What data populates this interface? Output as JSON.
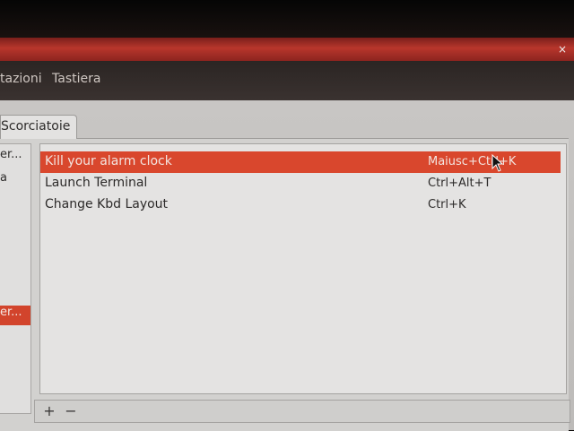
{
  "window": {
    "close_glyph": "×"
  },
  "menubar": {
    "items": [
      "tazioni",
      "Tastiera"
    ]
  },
  "tabs": {
    "active_label": "Scorciatoie"
  },
  "sidebar": {
    "items": [
      "er...",
      "a",
      "er..."
    ]
  },
  "shortcuts": {
    "rows": [
      {
        "name": "Kill your alarm clock",
        "accel": "Maiusc+Ctrl+K",
        "selected": true
      },
      {
        "name": "Launch Terminal",
        "accel": "Ctrl+Alt+T",
        "selected": false
      },
      {
        "name": "Change Kbd Layout",
        "accel": "Ctrl+K",
        "selected": false
      }
    ]
  },
  "toolbar": {
    "add_label": "+",
    "remove_label": "−"
  },
  "colors": {
    "accent": "#d9472d",
    "titlebar": "#b8362c"
  }
}
